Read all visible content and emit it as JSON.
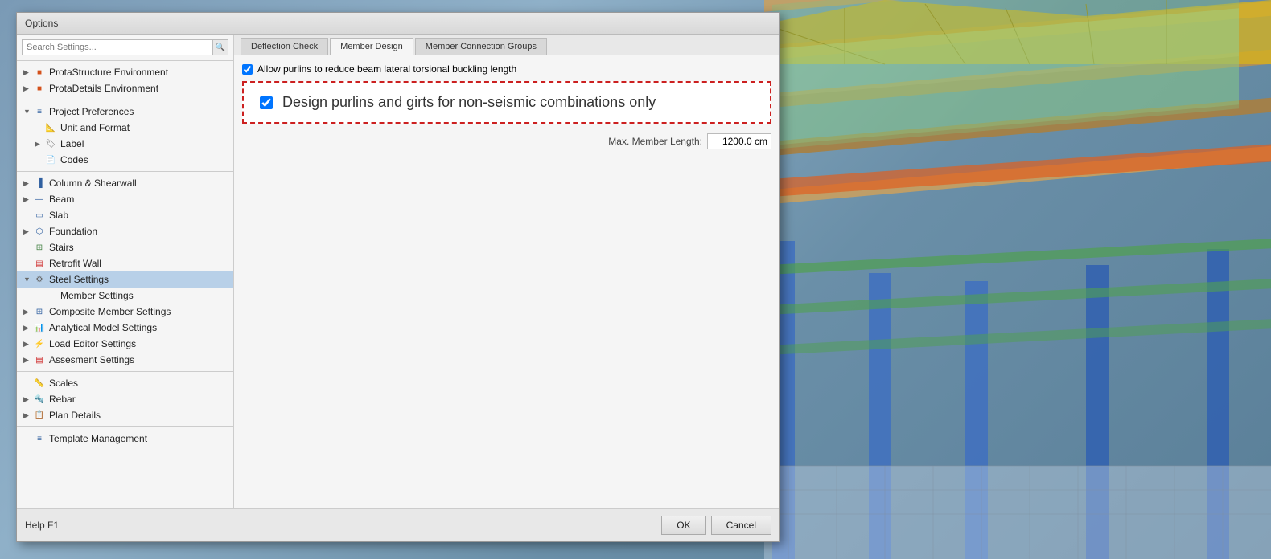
{
  "dialog": {
    "title": "Options",
    "search_placeholder": "Search Settings...",
    "tabs": [
      {
        "label": "Deflection Check",
        "active": false
      },
      {
        "label": "Member Design",
        "active": true
      },
      {
        "label": "Member Connection Groups",
        "active": false
      }
    ],
    "footer": {
      "help_label": "Help  F1",
      "ok_label": "OK",
      "cancel_label": "Cancel"
    }
  },
  "sidebar": {
    "items": [
      {
        "id": "prota-structure",
        "label": "ProtaStructure Environment",
        "indent": 1,
        "icon": "🔶",
        "expandable": true
      },
      {
        "id": "prota-details",
        "label": "ProtaDetails Environment",
        "indent": 1,
        "icon": "🔶",
        "expandable": true
      },
      {
        "id": "project-prefs",
        "label": "Project Preferences",
        "indent": 1,
        "icon": "📋",
        "expandable": true
      },
      {
        "id": "unit-format",
        "label": "Unit and Format",
        "indent": 2,
        "icon": "📐",
        "expandable": false
      },
      {
        "id": "label",
        "label": "Label",
        "indent": 2,
        "icon": "🏷",
        "expandable": true
      },
      {
        "id": "codes",
        "label": "Codes",
        "indent": 2,
        "icon": "📄",
        "expandable": false
      },
      {
        "id": "column-shearwall",
        "label": "Column & Shearwall",
        "indent": 1,
        "icon": "▐",
        "expandable": true
      },
      {
        "id": "beam",
        "label": "Beam",
        "indent": 1,
        "icon": "—",
        "expandable": true
      },
      {
        "id": "slab",
        "label": "Slab",
        "indent": 1,
        "icon": "▭",
        "expandable": false
      },
      {
        "id": "foundation",
        "label": "Foundation",
        "indent": 1,
        "icon": "⬡",
        "expandable": true
      },
      {
        "id": "stairs",
        "label": "Stairs",
        "indent": 1,
        "icon": "⊞",
        "expandable": false
      },
      {
        "id": "retrofit-wall",
        "label": "Retrofit Wall",
        "indent": 1,
        "icon": "▤",
        "expandable": false
      },
      {
        "id": "steel-settings",
        "label": "Steel Settings",
        "indent": 1,
        "icon": "⚙",
        "expandable": true,
        "selected": true
      },
      {
        "id": "member-settings",
        "label": "Member Settings",
        "indent": 2,
        "icon": "",
        "expandable": false,
        "child": true
      },
      {
        "id": "composite-member",
        "label": "Composite Member Settings",
        "indent": 1,
        "icon": "⊞",
        "expandable": true
      },
      {
        "id": "analytical-model",
        "label": "Analytical Model Settings",
        "indent": 1,
        "icon": "📊",
        "expandable": true
      },
      {
        "id": "load-editor",
        "label": "Load Editor Settings",
        "indent": 1,
        "icon": "⚡",
        "expandable": true
      },
      {
        "id": "assessment",
        "label": "Assesment Settings",
        "indent": 1,
        "icon": "▤",
        "expandable": true
      }
    ],
    "items2": [
      {
        "id": "scales",
        "label": "Scales",
        "indent": 1,
        "icon": "📏",
        "expandable": false
      },
      {
        "id": "rebar",
        "label": "Rebar",
        "indent": 1,
        "icon": "🔩",
        "expandable": true
      },
      {
        "id": "plan-details",
        "label": "Plan Details",
        "indent": 1,
        "icon": "📋",
        "expandable": true
      }
    ],
    "items3": [
      {
        "id": "template-mgmt",
        "label": "Template Management",
        "indent": 1,
        "icon": "📋",
        "expandable": false
      }
    ]
  },
  "main": {
    "checkbox1": {
      "label": "Allow purlins to reduce beam lateral torsional buckling length",
      "checked": true
    },
    "checkbox2": {
      "label": "Design purlins and girts for non-seismic combinations only",
      "checked": true,
      "highlighted": true
    },
    "max_member_length": {
      "label": "Max. Member Length:",
      "value": "1200.0 cm"
    }
  }
}
